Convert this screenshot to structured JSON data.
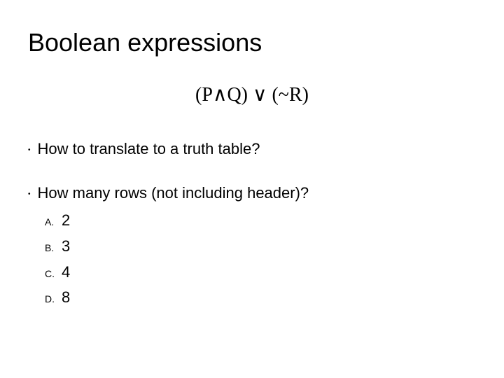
{
  "title": "Boolean expressions",
  "expression": "(P∧Q) ∨ (~R)",
  "bullets": [
    "How to translate to a truth table?",
    "How many rows (not including header)?"
  ],
  "options": [
    {
      "letter": "A.",
      "value": "2"
    },
    {
      "letter": "B.",
      "value": "3"
    },
    {
      "letter": "C.",
      "value": "4"
    },
    {
      "letter": "D.",
      "value": "8"
    }
  ]
}
